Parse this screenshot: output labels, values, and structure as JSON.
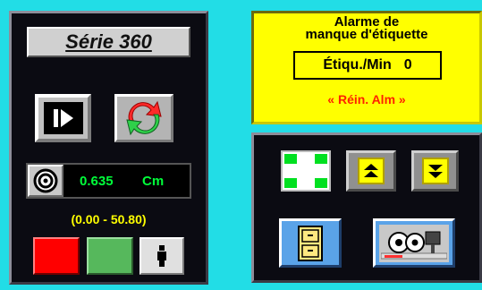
{
  "left_panel": {
    "series_title": "Série 360",
    "readout_value": "0.635",
    "readout_unit": "Cm",
    "range": "(0.00 - 50.80)"
  },
  "alarm_panel": {
    "title_line1": "Alarme de",
    "title_line2": "manque d'étiquette",
    "labels_per_min_label": "Étiqu./Min",
    "labels_per_min_value": "0",
    "reset_alarm": "« Réin. Alm »"
  },
  "icons": {
    "play": "play-step-icon",
    "sync": "sync-arrows-icon",
    "target": "target-icon",
    "figure": "figure-icon",
    "cross": "cross-icon",
    "up": "double-up-arrow-icon",
    "down": "double-down-arrow-icon",
    "cabinet": "file-cabinet-icon",
    "machine": "machine-settings-icon"
  },
  "colors": {
    "background": "#22dde6",
    "panel": "#0b0b12",
    "alarm_bg": "#ffff00",
    "readout_text": "#00ff3a",
    "range_text": "#ffff00",
    "reset_text": "#ff2200",
    "stop_button": "#ff0000",
    "start_button": "#56b85c",
    "blue_button": "#5aa3e8"
  }
}
